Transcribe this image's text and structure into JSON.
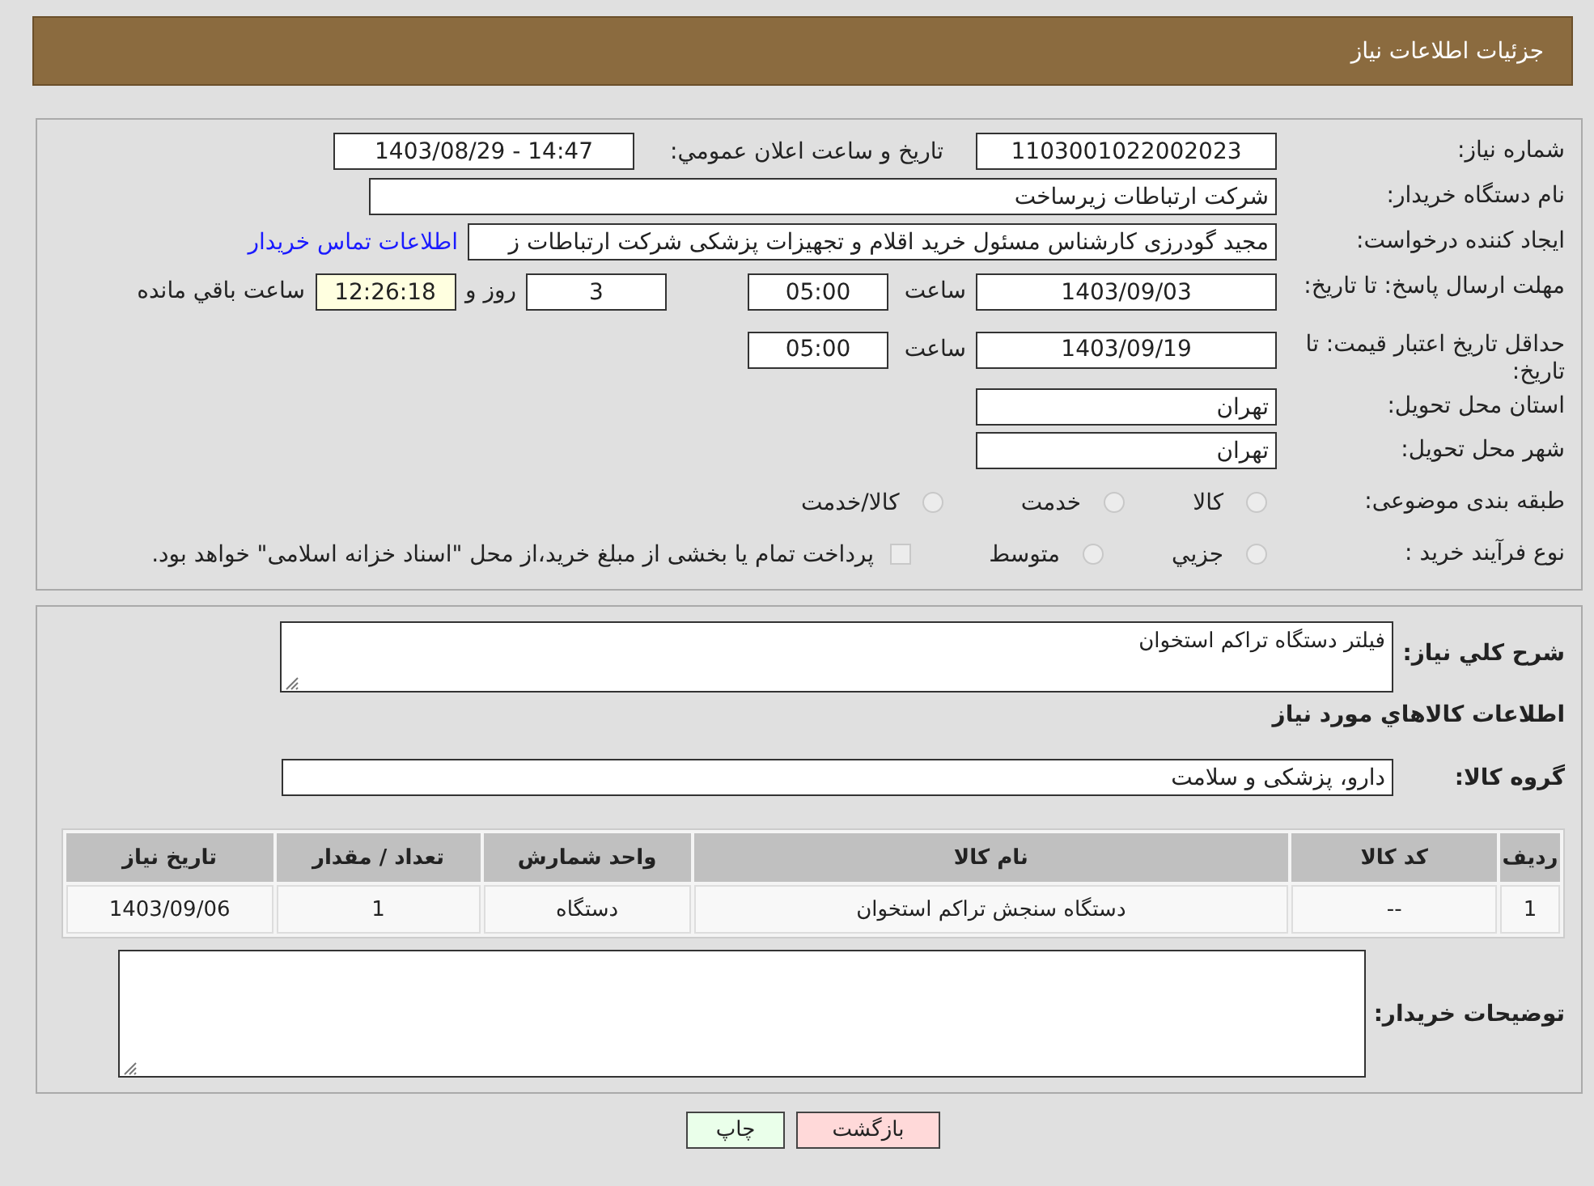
{
  "header": {
    "title": "جزئیات اطلاعات نیاز"
  },
  "details": {
    "need_number": {
      "label": "شماره نیاز:",
      "value": "1103001022002023"
    },
    "announce": {
      "label": "تاريخ و ساعت اعلان عمومي:",
      "value": "1403/08/29 - 14:47"
    },
    "buyer_org": {
      "label": "نام دستگاه خريدار:",
      "value": "شرکت ارتباطات زیرساخت"
    },
    "creator": {
      "label": "ایجاد کننده درخواست:",
      "value": "مجيد گودرزی کارشناس مسئول خرید اقلام و تجهیزات پزشکی شرکت ارتباطات ز",
      "link": "اطلاعات تماس خریدار"
    },
    "deadline": {
      "label": "مهلت ارسال پاسخ: تا تاریخ:",
      "date": "1403/09/03",
      "time_label": "ساعت",
      "time": "05:00",
      "days": "3",
      "days_label": "روز و",
      "remaining": "12:26:18",
      "remaining_label": "ساعت باقي مانده"
    },
    "validity": {
      "label": "حداقل تاریخ اعتبار قیمت: تا تاریخ:",
      "date": "1403/09/19",
      "time_label": "ساعت",
      "time": "05:00"
    },
    "province": {
      "label": "استان محل تحویل:",
      "value": "تهران"
    },
    "city": {
      "label": "شهر محل تحویل:",
      "value": "تهران"
    },
    "category": {
      "label": "طبقه بندی موضوعی:",
      "options": [
        {
          "label": "کالا",
          "selected": false
        },
        {
          "label": "خدمت",
          "selected": false
        },
        {
          "label": "کالا/خدمت",
          "selected": false
        }
      ]
    },
    "purchase_type": {
      "label": "نوع فرآیند خرید :",
      "options": [
        {
          "label": "جزيي",
          "selected": false
        },
        {
          "label": "متوسط",
          "selected": false
        }
      ],
      "treasury": {
        "label": "پرداخت تمام یا بخشی از مبلغ خرید،از محل \"اسناد خزانه اسلامی\" خواهد بود.",
        "checked": false
      }
    }
  },
  "goods": {
    "description": {
      "label": "شرح کلي نیاز:",
      "value": "فیلتر دستگاه تراکم استخوان"
    },
    "section_title": "اطلاعات کالاهاي مورد نياز",
    "group": {
      "label": "گروه کالا:",
      "value": "دارو، پزشکی و سلامت"
    },
    "table": {
      "columns": [
        "ردیف",
        "کد کالا",
        "نام کالا",
        "واحد شمارش",
        "تعداد / مقدار",
        "تاریخ نیاز"
      ],
      "rows": [
        [
          "1",
          "--",
          "دستگاه سنجش تراکم استخوان",
          "دستگاه",
          "1",
          "1403/09/06"
        ]
      ]
    },
    "buyer_notes": {
      "label": "توضیحات خریدار:"
    }
  },
  "buttons": [
    {
      "kind": "back",
      "label": "بازگشت"
    },
    {
      "kind": "print",
      "label": "چاپ"
    }
  ]
}
